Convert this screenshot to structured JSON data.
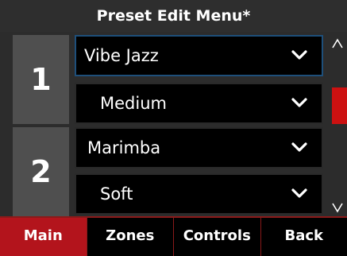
{
  "header": {
    "title": "Preset Edit Menu*"
  },
  "zones": [
    {
      "number": "1",
      "instrument": "Vibe Jazz",
      "level": "Medium"
    },
    {
      "number": "2",
      "instrument": "Marimba",
      "level": "Soft"
    }
  ],
  "scroll": {
    "up_icon": "caret-up-icon",
    "down_icon": "caret-down-icon"
  },
  "tabs": [
    {
      "label": "Main",
      "active": true
    },
    {
      "label": "Zones",
      "active": false
    },
    {
      "label": "Controls",
      "active": false
    },
    {
      "label": "Back",
      "active": false
    }
  ],
  "colors": {
    "accent": "#b3141c",
    "focus_border": "#1e4f7a",
    "zone_panel": "#4f4f4f"
  }
}
